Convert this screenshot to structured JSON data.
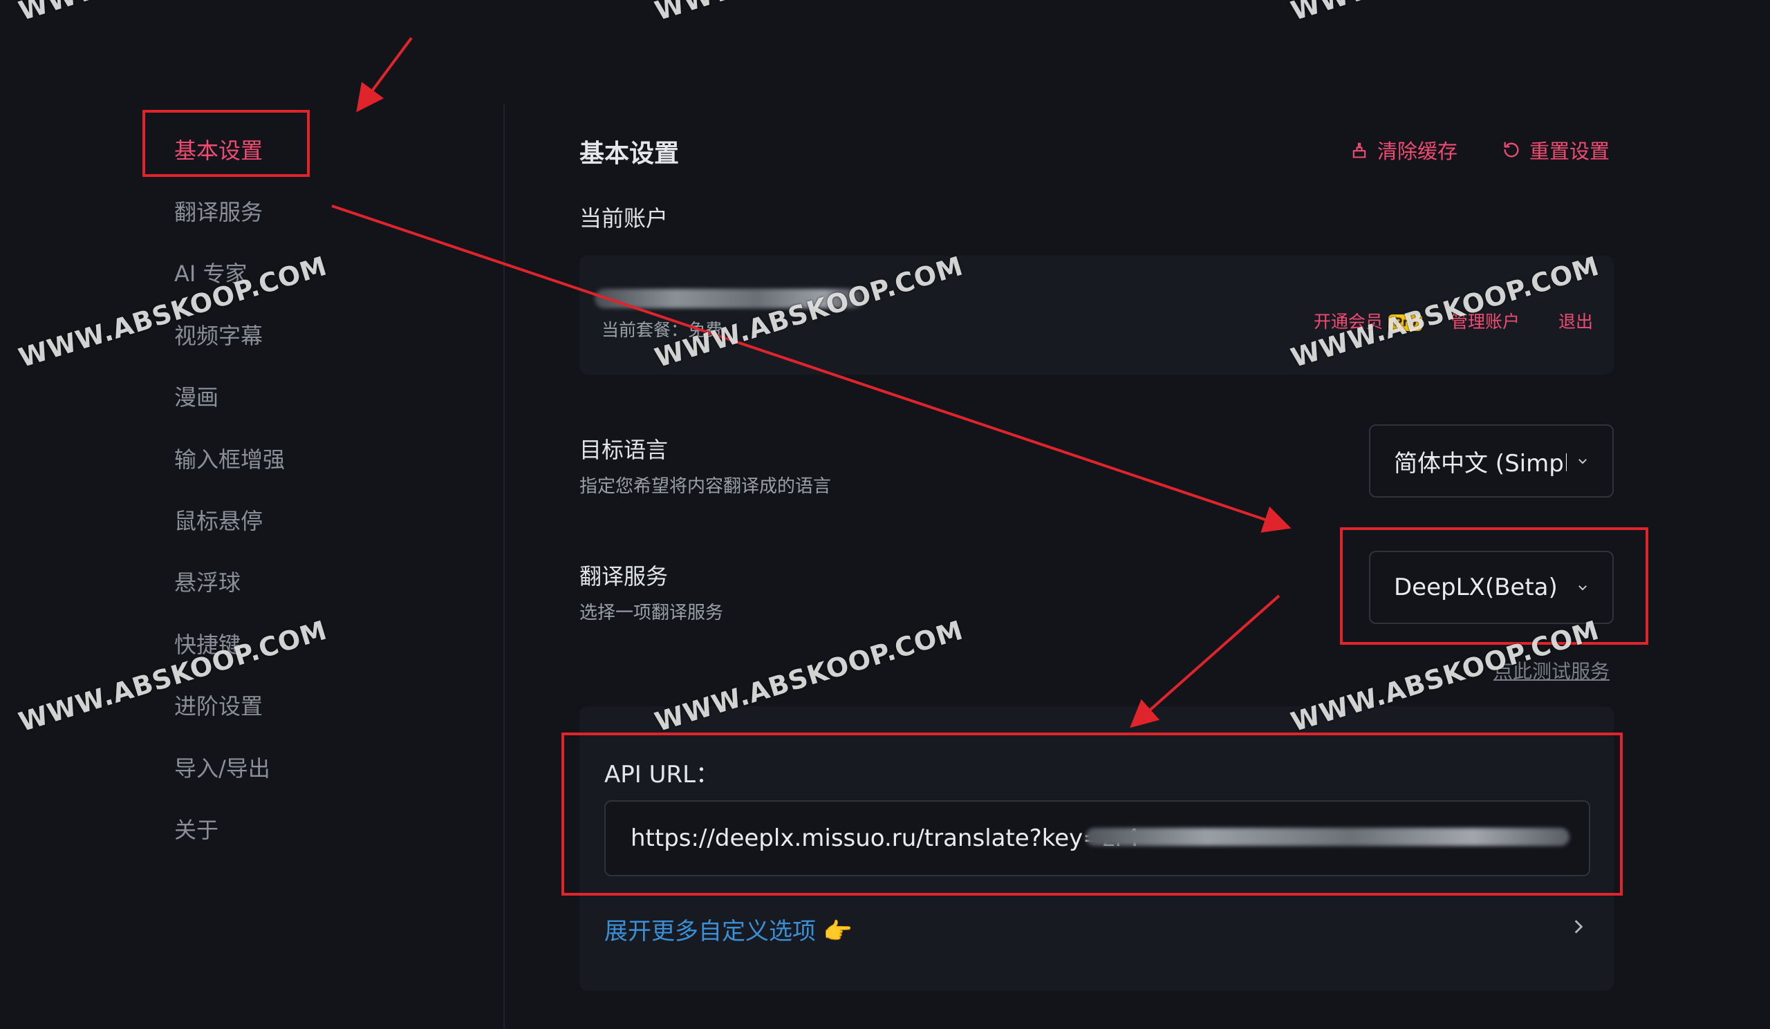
{
  "sidebar": {
    "items": [
      {
        "label": "基本设置",
        "active": true
      },
      {
        "label": "翻译服务"
      },
      {
        "label": "AI 专家"
      },
      {
        "label": "视频字幕"
      },
      {
        "label": "漫画"
      },
      {
        "label": "输入框增强"
      },
      {
        "label": "鼠标悬停"
      },
      {
        "label": "悬浮球"
      },
      {
        "label": "快捷键"
      },
      {
        "label": "进阶设置"
      },
      {
        "label": "导入/导出"
      },
      {
        "label": "关于"
      }
    ]
  },
  "header": {
    "title": "基本设置",
    "clear_cache_label": "清除缓存",
    "reset_label": "重置设置"
  },
  "account": {
    "section_label": "当前账户",
    "plan_text": "当前套餐：免费",
    "upgrade_label": "开通会员",
    "pro_badge": "Pro",
    "manage_label": "管理账户",
    "logout_label": "退出"
  },
  "target_language": {
    "title": "目标语言",
    "description": "指定您希望将内容翻译成的语言",
    "selected": "简体中文 (Simplified Chinese)"
  },
  "translation_service": {
    "title": "翻译服务",
    "description": "选择一项翻译服务",
    "selected": "DeepLX(Beta)",
    "test_link": "点此测试服务"
  },
  "custom": {
    "api_label": "API URL：",
    "api_value": "https://deeplx.missuo.ru/translate?key=zr4",
    "expand_label": "展开更多自定义选项 👉"
  },
  "watermark_text": "WWW.ABSKOOP.COM",
  "colors": {
    "accent": "#f04c73",
    "link": "#3b8fd6",
    "annotation": "#e0242c",
    "background": "#121419"
  }
}
